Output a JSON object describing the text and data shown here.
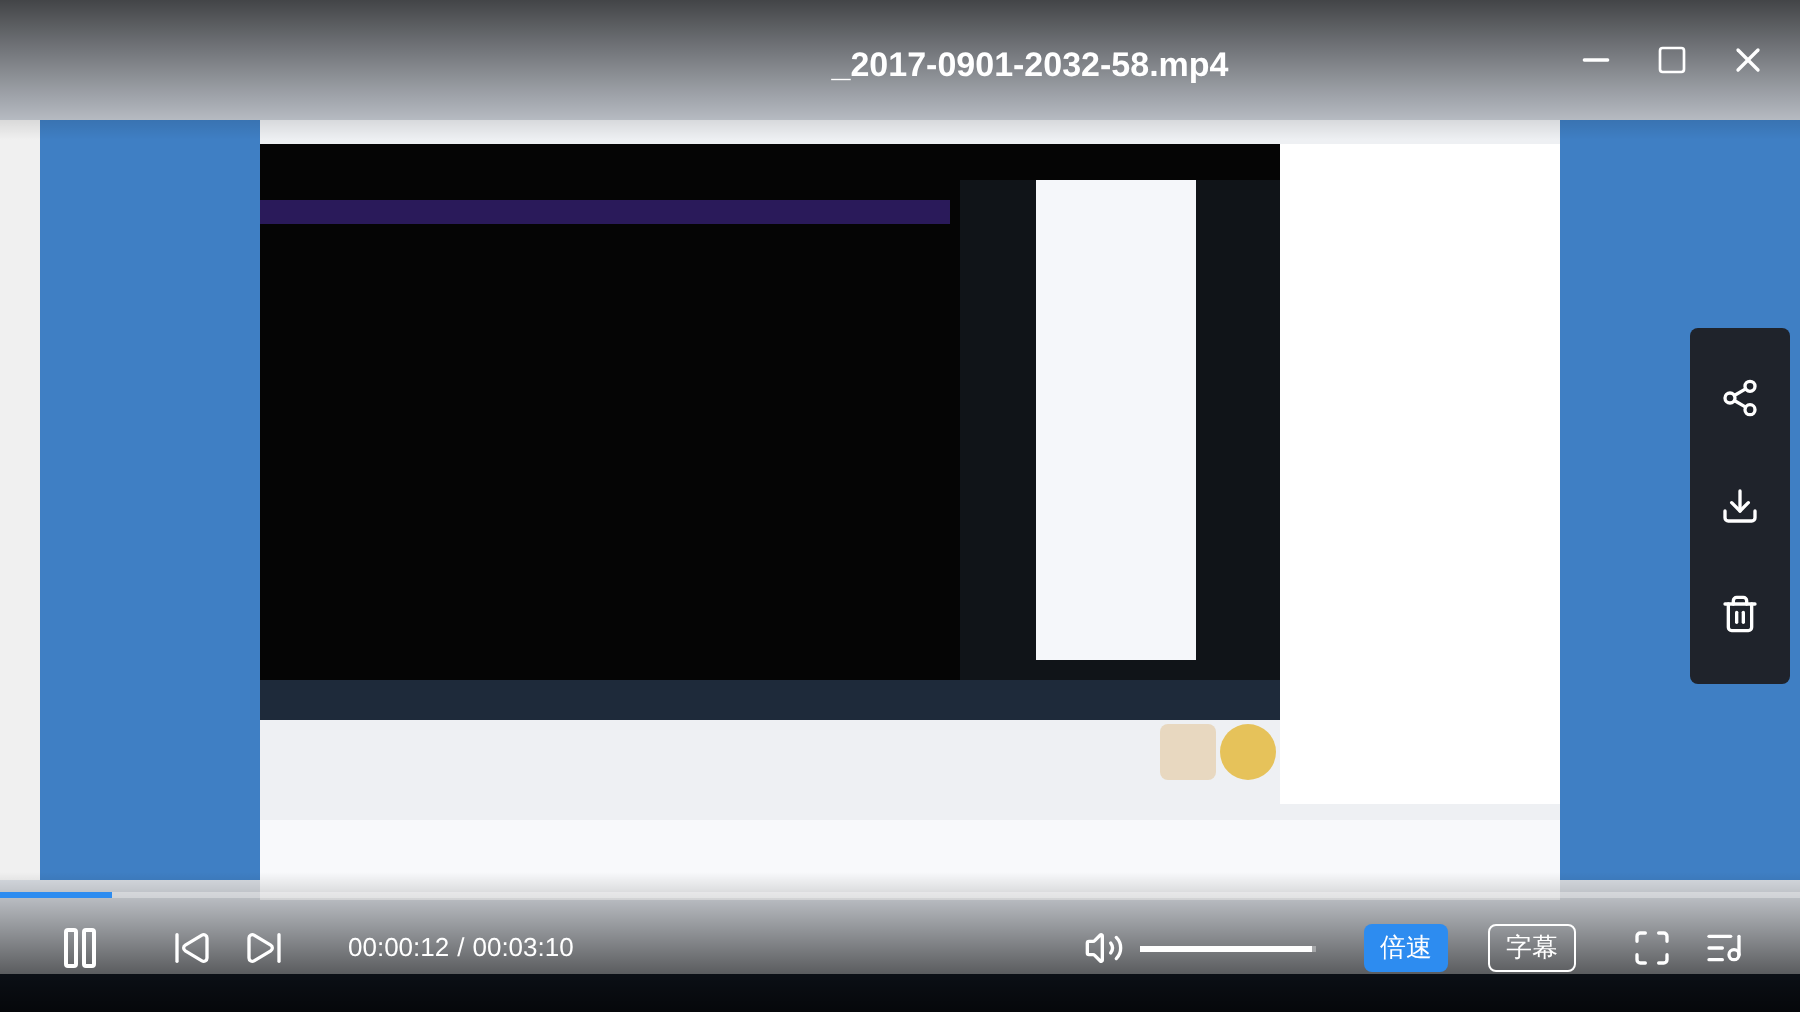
{
  "title": "_2017-0901-2032-58.mp4",
  "player": {
    "playing": true,
    "progress": {
      "level": 0.062
    },
    "current_time": "00:00:12",
    "separator": "/",
    "duration": "00:03:10",
    "volume": {
      "level": 0.98
    },
    "speed_button": "倍速",
    "subtitle_button": "字幕"
  }
}
